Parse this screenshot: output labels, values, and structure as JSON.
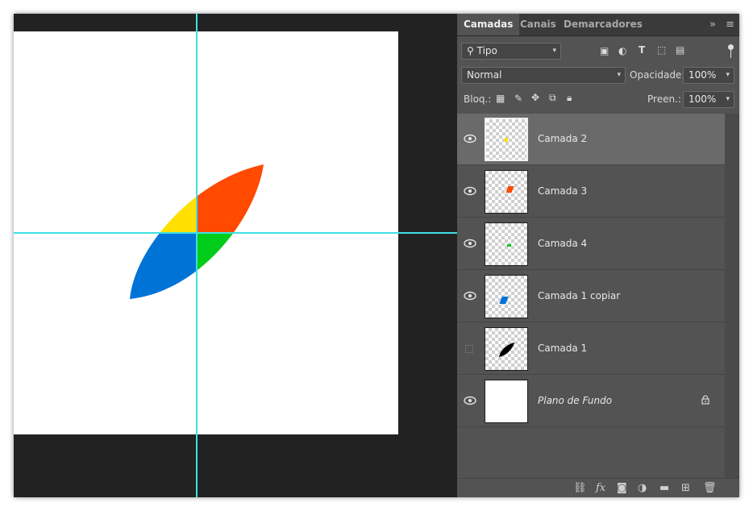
{
  "tabs": [
    {
      "label": "Camadas",
      "active": true
    },
    {
      "label": "Canais",
      "active": false
    },
    {
      "label": "Demarcadores",
      "active": false
    }
  ],
  "panel_menu": {
    "collapse_glyph": "»",
    "menu_glyph": "≡"
  },
  "filter": {
    "value": "Tipo",
    "icons": [
      "image-filter-icon",
      "adjustment-filter-icon",
      "type-filter-icon",
      "shape-filter-icon",
      "smart-object-filter-icon"
    ]
  },
  "blend": {
    "mode": "Normal",
    "opacity_label": "Opacidade:",
    "opacity_value": "100%"
  },
  "lock": {
    "label": "Bloq.:",
    "fill_label": "Preen.:",
    "fill_value": "100%"
  },
  "layers": [
    {
      "name": "Camada 2",
      "visible": true,
      "selected": true,
      "italic": false,
      "thumb": "yellow",
      "locked": false
    },
    {
      "name": "Camada 3",
      "visible": true,
      "selected": false,
      "italic": false,
      "thumb": "red",
      "locked": false
    },
    {
      "name": "Camada 4",
      "visible": true,
      "selected": false,
      "italic": false,
      "thumb": "green",
      "locked": false
    },
    {
      "name": "Camada 1 copiar",
      "visible": true,
      "selected": false,
      "italic": false,
      "thumb": "blue",
      "locked": false
    },
    {
      "name": "Camada 1",
      "visible": false,
      "selected": false,
      "italic": false,
      "thumb": "black",
      "locked": false
    },
    {
      "name": "Plano de Fundo",
      "visible": true,
      "selected": false,
      "italic": true,
      "thumb": "white",
      "locked": true
    }
  ],
  "colors": {
    "yellow": "#ffe000",
    "red": "#ff4a00",
    "green": "#00cc1a",
    "blue": "#0073d6",
    "guide": "#3fe0e0",
    "panel": "#535353",
    "selected": "#6a6a6a"
  },
  "bottom_icons": [
    "link-icon",
    "fx-icon",
    "mask-icon",
    "adjustment-icon",
    "folder-icon",
    "new-layer-icon",
    "trash-icon"
  ]
}
